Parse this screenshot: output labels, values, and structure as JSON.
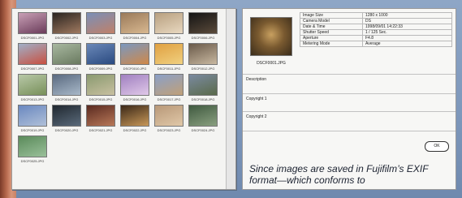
{
  "thumbnails": [
    {
      "caption": "DSCF0001.JPG",
      "colors": [
        "#c9a0b6",
        "#6a3c5a"
      ]
    },
    {
      "caption": "DSCF0002.JPG",
      "colors": [
        "#2a2420",
        "#a07a60"
      ]
    },
    {
      "caption": "DSCF0003.JPG",
      "colors": [
        "#7a90b8",
        "#c08068"
      ]
    },
    {
      "caption": "DSCF0004.JPG",
      "colors": [
        "#9a7a5a",
        "#d8b890"
      ]
    },
    {
      "caption": "DSCF0005.JPG",
      "colors": [
        "#b8a080",
        "#e8d8c0"
      ]
    },
    {
      "caption": "DSCF0006.JPG",
      "colors": [
        "#141414",
        "#5a4a3a"
      ]
    },
    {
      "caption": "DSCF0007.JPG",
      "colors": [
        "#a0b0c8",
        "#c85040"
      ]
    },
    {
      "caption": "DSCF0008.JPG",
      "colors": [
        "#a8b8a0",
        "#6a7a60"
      ]
    },
    {
      "caption": "DSCF0009.JPG",
      "colors": [
        "#6a88b8",
        "#2a4a80"
      ]
    },
    {
      "caption": "DSCF0010.JPG",
      "colors": [
        "#7a98c0",
        "#d08848"
      ]
    },
    {
      "caption": "DSCF0011.JPG",
      "colors": [
        "#e0a040",
        "#f0d080"
      ]
    },
    {
      "caption": "DSCF0012.JPG",
      "colors": [
        "#6a5a4a",
        "#c8b8a0"
      ]
    },
    {
      "caption": "DSCF0013.JPG",
      "colors": [
        "#b8c8a8",
        "#78905a"
      ]
    },
    {
      "caption": "DSCF0014.JPG",
      "colors": [
        "#5a6a80",
        "#a8b8c8"
      ]
    },
    {
      "caption": "DSCF0015.JPG",
      "colors": [
        "#8a9a70",
        "#c8c0a0"
      ]
    },
    {
      "caption": "DSCF0016.JPG",
      "colors": [
        "#a080c0",
        "#e0c8e8"
      ]
    },
    {
      "caption": "DSCF0017.JPG",
      "colors": [
        "#8aa0c8",
        "#c0a078"
      ]
    },
    {
      "caption": "DSCF0018.JPG",
      "colors": [
        "#7a8aa0",
        "#5a6a4a"
      ]
    },
    {
      "caption": "DSCF0019.JPG",
      "colors": [
        "#6a88c0",
        "#b0c0d8"
      ]
    },
    {
      "caption": "DSCF0020.JPG",
      "colors": [
        "#202830",
        "#5a6a7a"
      ]
    },
    {
      "caption": "DSCF0021.JPG",
      "colors": [
        "#5a2a20",
        "#b87858"
      ]
    },
    {
      "caption": "DSCF0022.JPG",
      "colors": [
        "#3a2818",
        "#c89858"
      ]
    },
    {
      "caption": "DSCF0023.JPG",
      "colors": [
        "#b89878",
        "#e0c8a8"
      ]
    },
    {
      "caption": "DSCF0024.JPG",
      "colors": [
        "#405a40",
        "#8aa080"
      ]
    },
    {
      "caption": "DSCF0025.JPG",
      "colors": [
        "#5a8a5a",
        "#9ac09a"
      ]
    }
  ],
  "info": {
    "preview_caption": "DSCF0001.JPG",
    "metadata": [
      {
        "label": "Image Size",
        "value": "1280 x 1000"
      },
      {
        "label": "Camera Model",
        "value": "DS"
      },
      {
        "label": "Date & Time",
        "value": "1998/09/01 14:22:33"
      },
      {
        "label": "Shutter Speed",
        "value": "1 / 125 Sec."
      },
      {
        "label": "Aperture",
        "value": "F4.8"
      },
      {
        "label": "Metering Mode",
        "value": "Average"
      }
    ],
    "description_label": "Description",
    "copyright1_label": "Copyright 1",
    "copyright2_label": "Copyright 2",
    "ok_label": "OK"
  },
  "caption": "Since images are saved in Fujifilm’s EXIF format—which conforms to"
}
